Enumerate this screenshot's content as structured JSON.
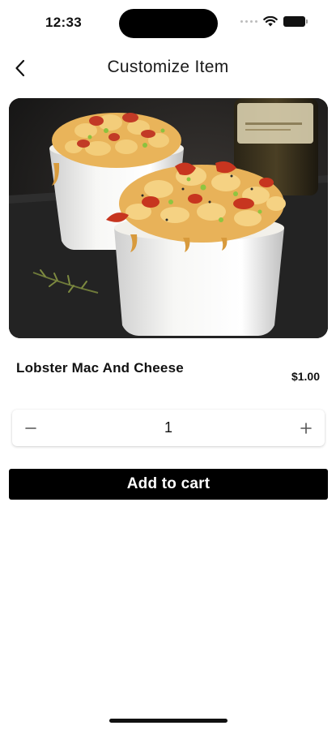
{
  "status_bar": {
    "time": "12:33",
    "icons": [
      "signal-dots-icon",
      "wifi-icon",
      "battery-icon"
    ]
  },
  "header": {
    "title": "Customize Item",
    "back_icon": "chevron-left-icon"
  },
  "item": {
    "image_description": "",
    "name": "Lobster Mac And Cheese",
    "price": "$1.00"
  },
  "quantity": {
    "value": "1",
    "minus_icon": "minus-icon",
    "plus_icon": "plus-icon"
  },
  "actions": {
    "add_to_cart_label": "Add to cart"
  },
  "colors": {
    "primary_button": "#000000",
    "button_text": "#ffffff",
    "background": "#ffffff"
  }
}
